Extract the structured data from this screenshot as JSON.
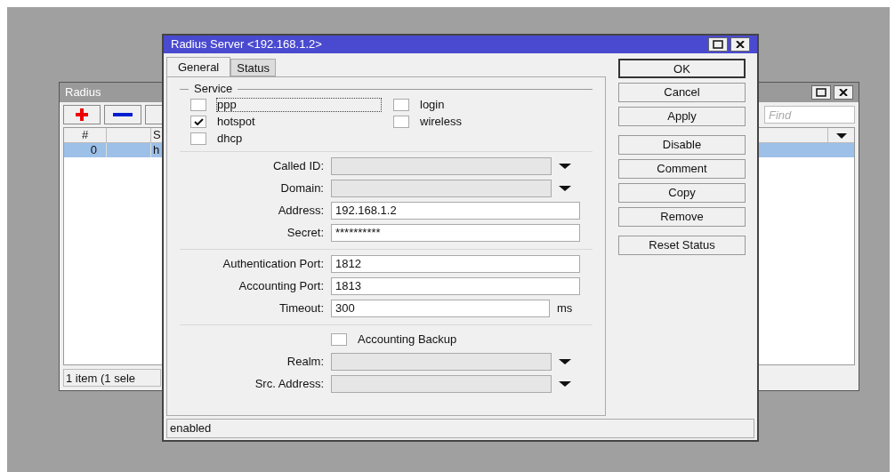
{
  "background_window": {
    "title": "Radius",
    "toolbar": [
      {
        "kind": "add"
      },
      {
        "kind": "remove"
      }
    ],
    "find": {
      "placeholder": "Find"
    },
    "columns": [
      {
        "label": "#"
      },
      {
        "label": "S"
      }
    ],
    "rows": [
      {
        "cells": [
          "0",
          "h"
        ],
        "selected": true
      }
    ],
    "status_bar": "1 item (1 sele"
  },
  "dialog": {
    "title": "Radius Server <192.168.1.2>",
    "tabs": [
      {
        "label": "General",
        "selected": true
      },
      {
        "label": "Status",
        "selected": false
      }
    ],
    "service": {
      "legend": "Service",
      "options": [
        {
          "label": "ppp",
          "checked": false,
          "focused": true
        },
        {
          "label": "login",
          "checked": false,
          "focused": false
        },
        {
          "label": "hotspot",
          "checked": true,
          "focused": false
        },
        {
          "label": "wireless",
          "checked": false,
          "focused": false
        },
        {
          "label": "dhcp",
          "checked": false,
          "focused": false
        }
      ]
    },
    "groups": [
      [
        {
          "kind": "combo",
          "label": "Called ID:"
        },
        {
          "kind": "combo",
          "label": "Domain:"
        },
        {
          "kind": "text",
          "label": "Address:",
          "value": "192.168.1.2"
        },
        {
          "kind": "text",
          "label": "Secret:",
          "value": "**********"
        }
      ],
      [
        {
          "kind": "text",
          "label": "Authentication Port:",
          "value": "1812"
        },
        {
          "kind": "text",
          "label": "Accounting Port:",
          "value": "1813"
        },
        {
          "kind": "unit",
          "label": "Timeout:",
          "value": "300",
          "unit": "ms"
        }
      ],
      [
        {
          "kind": "checkbox",
          "label": "Accounting Backup",
          "checked": false
        },
        {
          "kind": "combo",
          "label": "Realm:"
        },
        {
          "kind": "combo",
          "label": "Src. Address:"
        }
      ]
    ],
    "button_groups": [
      [
        {
          "label": "OK",
          "default": true
        },
        {
          "label": "Cancel",
          "default": false
        },
        {
          "label": "Apply",
          "default": false
        }
      ],
      [
        {
          "label": "Disable",
          "default": false
        },
        {
          "label": "Comment",
          "default": false
        },
        {
          "label": "Copy",
          "default": false
        },
        {
          "label": "Remove",
          "default": false
        }
      ],
      [
        {
          "label": "Reset Status",
          "default": false
        }
      ]
    ],
    "status_bar": "enabled"
  }
}
